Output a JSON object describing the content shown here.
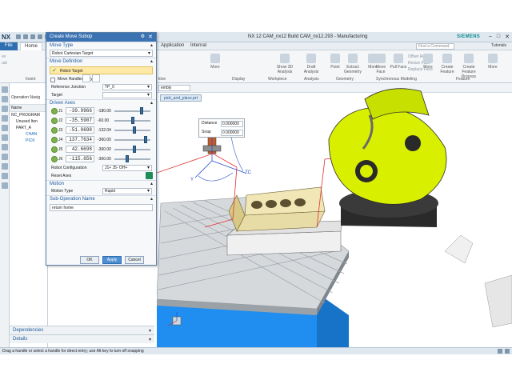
{
  "window": {
    "app_logo": "NX",
    "title": "NX 12 CAM_nx12 Build CAM_nx12.293 - Manufacturing",
    "brand": "SIEMENS",
    "controls": [
      "–",
      "□",
      "✕"
    ]
  },
  "menu": {
    "file": "File",
    "home": "Home",
    "application": "Application",
    "internal": "Internal",
    "find_placeholder": "Find a Command",
    "tutorials": "Tutorials"
  },
  "ribbon": {
    "buttons": [
      "More",
      "Show 3D Analysis",
      "Draft Analysis",
      "Point",
      "Extract Geometry",
      "More",
      "Move Face",
      "Pull Face",
      "Offset Region",
      "Resize Face",
      "Replace Face",
      "More",
      "Create Feature",
      "Create Feature Process",
      "More"
    ],
    "groups": [
      "kine",
      "Display",
      "Workpiece",
      "Analysis",
      "Geometry",
      "Synchronous Modeling",
      "Feature"
    ],
    "left_small": [
      "ve",
      "ual",
      "Insert"
    ],
    "offset_region": "Offset Region",
    "resize_face": "Resize Face",
    "replace_face": "Replace Face"
  },
  "navigator": {
    "title": "Operation Navig",
    "column": "Name",
    "items": [
      "NC_PROGRAM",
      "Unused Iten",
      "PART_A",
      "CHAN",
      "PICK"
    ]
  },
  "dialog": {
    "title": "Create Move Subop",
    "move_type_section": "Move Type",
    "move_type_value": "Robot Cartesian Target",
    "move_definition_section": "Move Definition",
    "robot_target_label": "Robot Target",
    "move_handles_only": "Move Handles Only",
    "reference_junction_label": "Reference Junction",
    "reference_junction_value": "TP_0",
    "target_label": "Target",
    "driven_axes_label": "Driven Axes",
    "axes": [
      {
        "name": "J1",
        "value": "-39.9966",
        "limit": "-180.00",
        "level": 0.78
      },
      {
        "name": "J2",
        "value": "-35.5907",
        "limit": "-60.00",
        "level": 0.5
      },
      {
        "name": "J3",
        "value": "-51.0698",
        "limit": "-132.04",
        "level": 0.55
      },
      {
        "name": "J4",
        "value": "137.7634",
        "limit": "-360.00",
        "level": 0.9
      },
      {
        "name": "J5",
        "value": "42.6698",
        "limit": "-360.00",
        "level": 0.55
      },
      {
        "name": "J6",
        "value": "-115.656",
        "limit": "-360.00",
        "level": 0.35
      }
    ],
    "robot_config_label": "Robot Configuration",
    "robot_config_value": "J1+ J5- OH+",
    "reset_axes": "Reset Axes",
    "motion_section": "Motion",
    "motion_type_label": "Motion Type",
    "motion_type_value": "Rapid",
    "subop_name_section": "Sub-Operation Name",
    "subop_name_value": "return home",
    "ok": "OK",
    "apply": "Apply",
    "cancel": "Cancel"
  },
  "panels": {
    "dependencies": "Dependencies",
    "details": "Details"
  },
  "graphics": {
    "filter": "embly",
    "tab": "pick_and_place.prt",
    "distance_label": "Distance",
    "distance_value": "0.000000",
    "snap_label": "Snap",
    "snap_value": "0.000000",
    "axis_x": "X",
    "axis_y": "Y",
    "axis_z": "ZC",
    "axis_zc2": "ZC"
  },
  "status": {
    "text": "Drag a handle or select a handle for direct entry; use Alt key to turn off snapping"
  },
  "colors": {
    "robot": "#d8f000",
    "robot_dark": "#2a2a2a",
    "table": "#dcdcdc",
    "stand": "#1f8ef0",
    "accent": "#3b73b2",
    "highlight": "#ffe9a6"
  }
}
